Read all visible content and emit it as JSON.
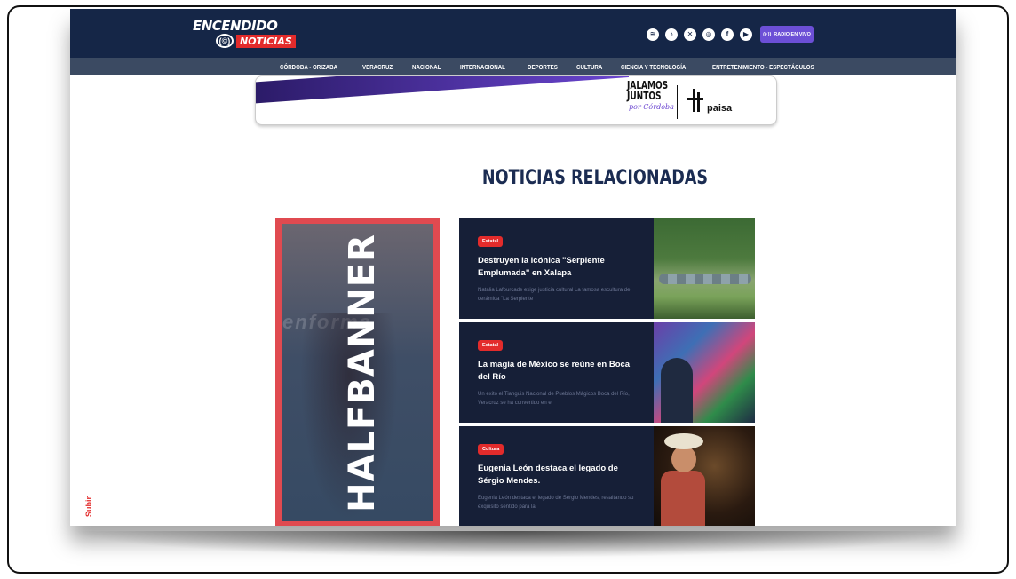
{
  "header": {
    "logo_top": "ENCENDIDO",
    "logo_mark": "(©)",
    "logo_badge": "NOTICIAS",
    "radio_button_label": "RADIO EN VIVO",
    "social_icons": [
      "spotify-icon",
      "tiktok-icon",
      "x-icon",
      "instagram-icon",
      "facebook-icon",
      "youtube-icon"
    ]
  },
  "nav": {
    "items": [
      "CÓRDOBA - ORIZABA",
      "VERACRUZ",
      "NACIONAL",
      "INTERNACIONAL",
      "DEPORTES",
      "CULTURA",
      "CIENCIA Y TECNOLOGÍA",
      "ENTRETENIMIENTO - ESPECTÁCULOS"
    ]
  },
  "promo": {
    "line1": "JALAMOS",
    "line2": "JUNTOS",
    "script": "por Córdoba",
    "brand": "paisa"
  },
  "section_title": "NOTICIAS RELACIONADAS",
  "halfbanner": {
    "text": "HALFBANNER",
    "watermark": "enforma"
  },
  "scroll_top_label": "Subir",
  "news": [
    {
      "tag": "Estatal",
      "title": "Destruyen la icónica \"Serpiente Emplumada\" en Xalapa",
      "excerpt": "Natalia Lafourcade exige justicia cultural La famosa escultura de cerámica \"La Serpiente"
    },
    {
      "tag": "Estatal",
      "title": "La magia de México se reúne en Boca del Río",
      "excerpt": "Un éxito el Tianguis Nacional de Pueblos Mágicos Boca del Río, Veracruz se ha convertido en el"
    },
    {
      "tag": "Cultura",
      "title": "Eugenia León destaca el legado de Sérgio Mendes.",
      "excerpt": "Eugenia León destaca el legado de Sérgio Mendes, resaltando su exquisito sentido para la"
    }
  ],
  "colors": {
    "header_bg": "#152647",
    "nav_bg": "#3b4a62",
    "accent_red": "#e32b2b",
    "radio_purple": "#6c4fd6",
    "card_bg": "#161f37",
    "title_navy": "#1b2c52"
  }
}
